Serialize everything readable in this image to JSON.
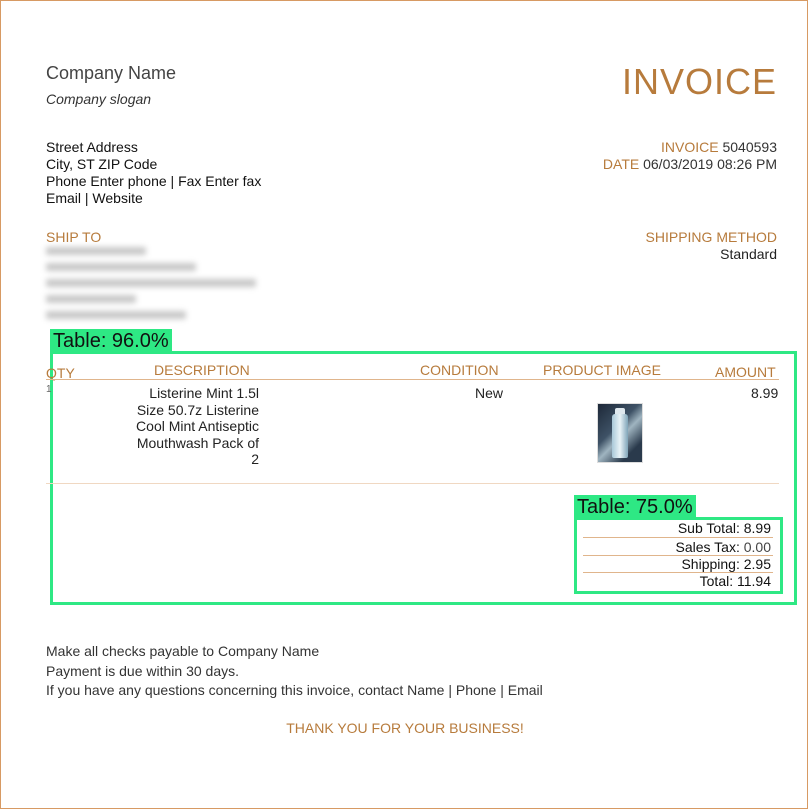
{
  "company": {
    "name": "Company Name",
    "slogan": "Company slogan",
    "address_lines": [
      "Street Address",
      "City, ST ZIP Code",
      "Phone Enter phone | Fax Enter fax",
      "Email | Website"
    ]
  },
  "title": "INVOICE",
  "meta": {
    "invoice_label": "INVOICE",
    "invoice_value": "5040593",
    "date_label": "DATE",
    "date_value": "06/03/2019 08:26 PM"
  },
  "ship_to": {
    "label": "SHIP TO"
  },
  "shipping_method": {
    "label": "SHIPPING METHOD",
    "value": "Standard"
  },
  "detections": [
    {
      "label": "Table: 96.0%"
    },
    {
      "label": "Table: 75.0%"
    }
  ],
  "table": {
    "headers": {
      "qty": "QTY",
      "description": "DESCRIPTION",
      "condition": "CONDITION",
      "image": "PRODUCT IMAGE",
      "amount": "AMOUNT"
    },
    "row": {
      "qty": "1",
      "description_lines": [
        "Listerine Mint  1.5l",
        "Size 50.7z Listerine",
        "Cool Mint Antiseptic",
        "Mouthwash  Pack of",
        "2"
      ],
      "condition": "New",
      "amount": "8.99"
    }
  },
  "totals": [
    {
      "label": "Sub Total:",
      "value": "8.99"
    },
    {
      "label": "Sales Tax:",
      "value": "0.00"
    },
    {
      "label": "Shipping:",
      "value": "2.95"
    },
    {
      "label": "Total:",
      "value": "11.94"
    }
  ],
  "footer": {
    "lines": [
      "Make all checks payable to Company Name",
      "Payment is due within 30 days.",
      "If you have any questions concerning this invoice, contact Name | Phone | Email"
    ],
    "thanks": "THANK YOU FOR YOUR BUSINESS!"
  },
  "colors": {
    "accent": "#b77b3c",
    "detection": "#2ee884",
    "rule": "#e0b58c"
  }
}
